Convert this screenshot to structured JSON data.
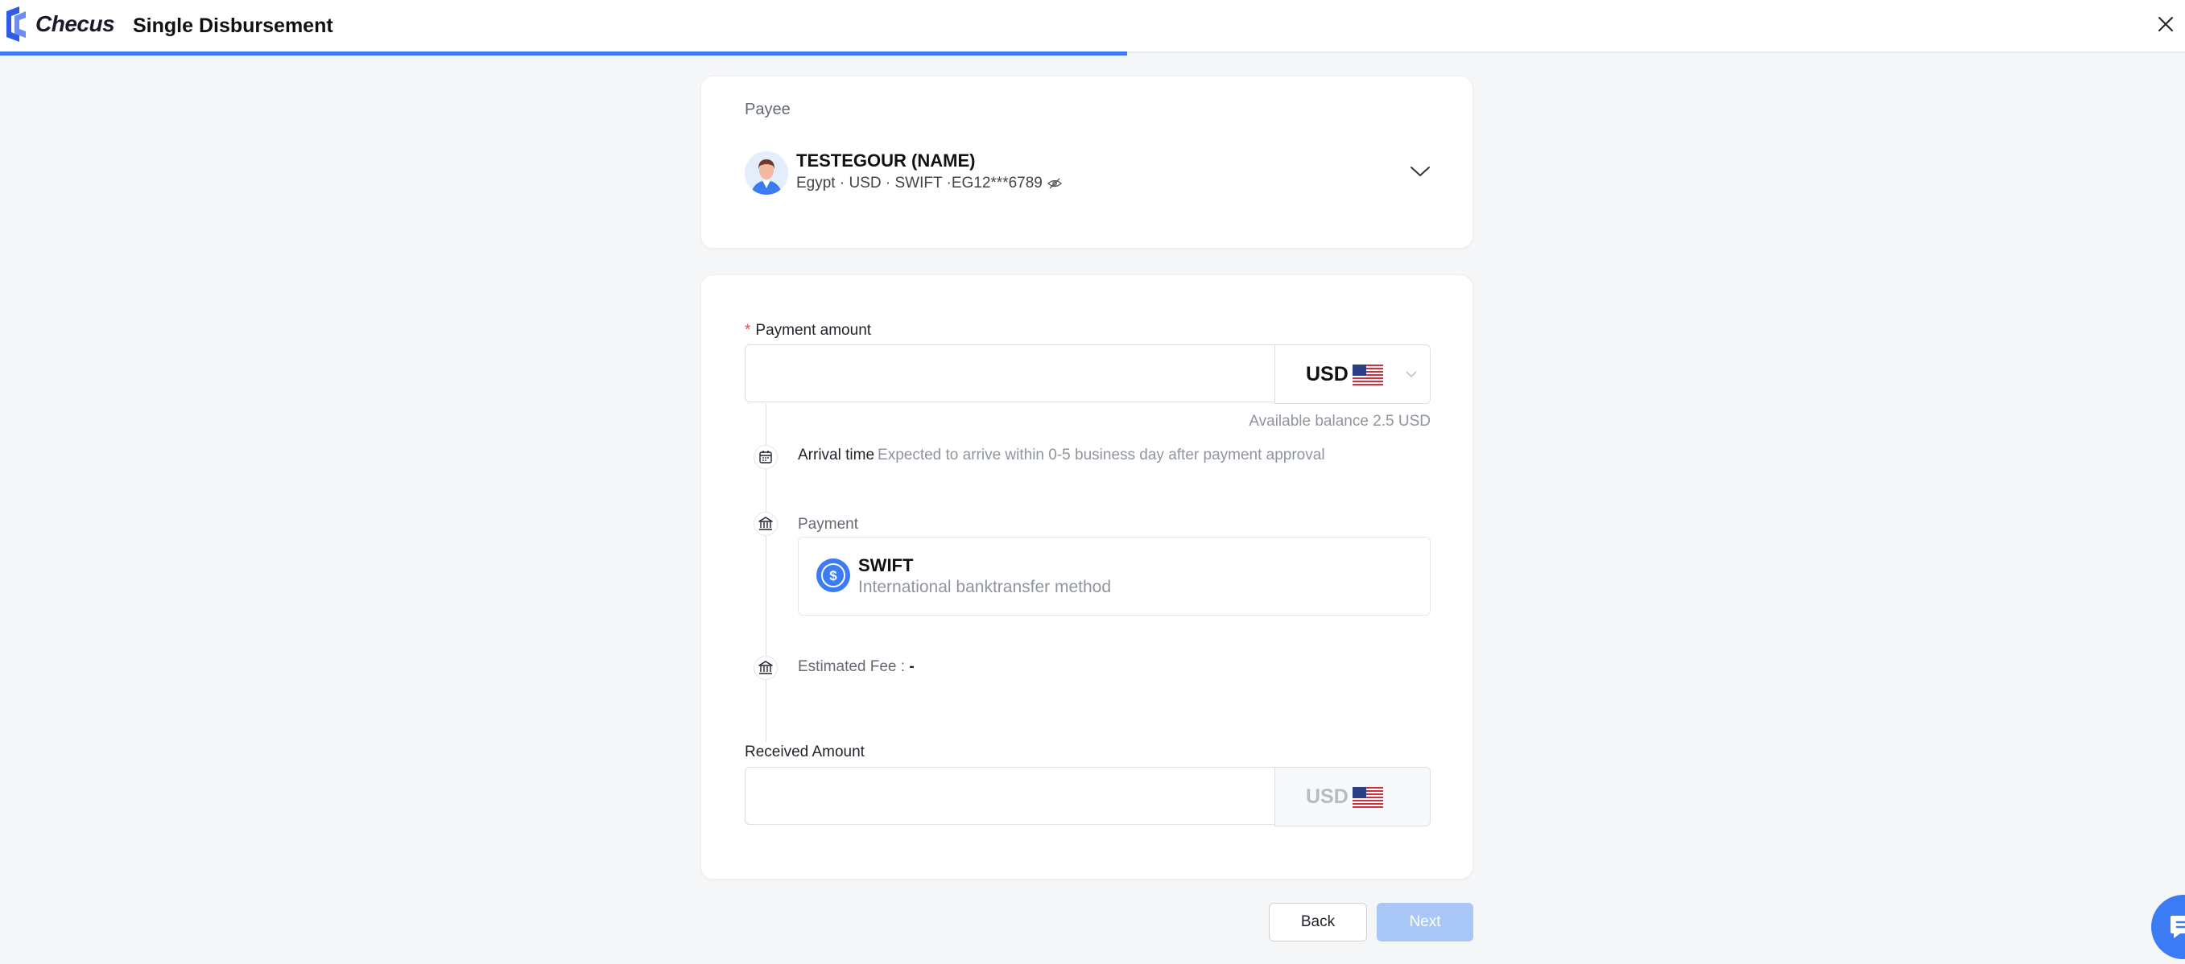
{
  "header": {
    "brand": "Checus",
    "title": "Single Disbursement",
    "progress_fraction": 0.516
  },
  "payee": {
    "label": "Payee",
    "name": "TESTEGOUR (NAME)",
    "details": "Egypt · USD · SWIFT ·EG12***6789"
  },
  "payment_amount": {
    "label": "Payment amount",
    "value": "",
    "currency": "USD",
    "available_balance": "Available balance 2.5 USD"
  },
  "arrival": {
    "title": "Arrival time",
    "description": "Expected to arrive within 0-5 business day after payment approval"
  },
  "payment_method": {
    "label": "Payment",
    "name": "SWIFT",
    "description": "International banktransfer method"
  },
  "fee": {
    "label": "Estimated Fee : ",
    "value": "-"
  },
  "received_amount": {
    "label": "Received Amount",
    "value": "",
    "currency": "USD"
  },
  "buttons": {
    "back": "Back",
    "next": "Next"
  },
  "colors": {
    "accent": "#3b7cf5",
    "next_disabled": "#a9c7f6",
    "required": "#f54a45",
    "background": "#f5f6f7"
  },
  "icons": {
    "logo": "checus-logo-icon",
    "close": "close-icon",
    "eye": "eye-hidden-icon",
    "chevron": "chevron-down-icon",
    "calendar": "calendar-icon",
    "bank": "bank-icon",
    "dollar": "dollar-circle-icon",
    "chat": "chat-icon",
    "flag": "us-flag-icon"
  }
}
